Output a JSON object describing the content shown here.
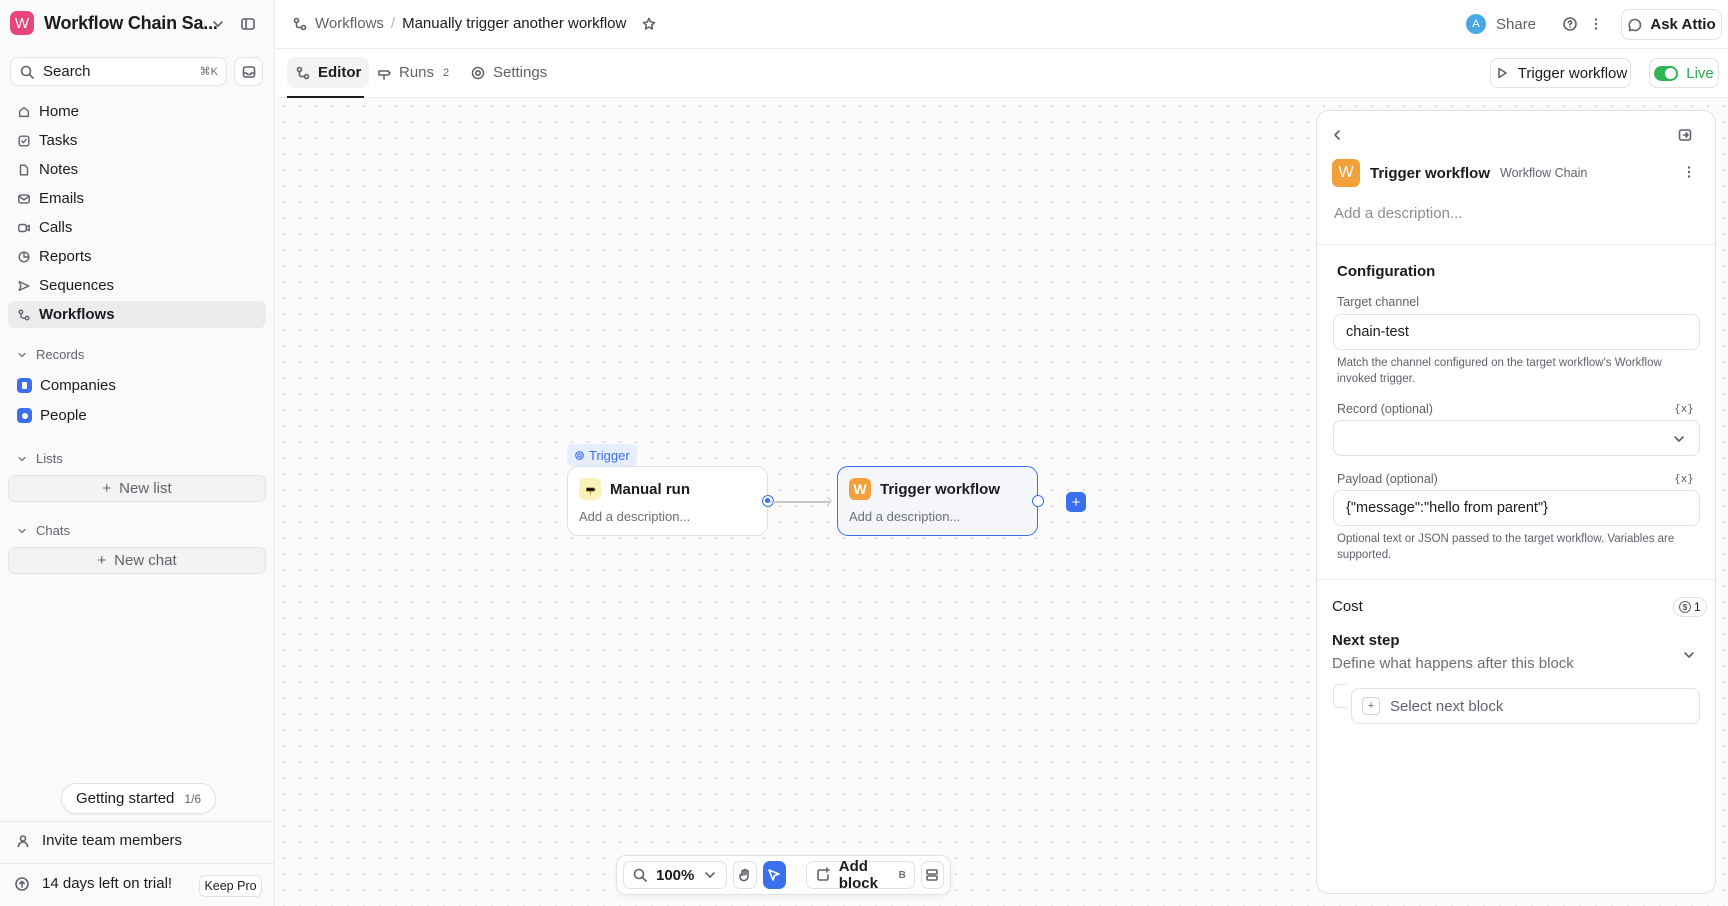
{
  "workspace": {
    "logo": "W",
    "name": "Workflow Chain Sa...",
    "logo_color": "#e8467c"
  },
  "search": {
    "label": "Search",
    "shortcut": "⌘K"
  },
  "nav": [
    {
      "label": "Home",
      "icon": "home-icon"
    },
    {
      "label": "Tasks",
      "icon": "checkbox-icon"
    },
    {
      "label": "Notes",
      "icon": "note-icon"
    },
    {
      "label": "Emails",
      "icon": "mail-icon"
    },
    {
      "label": "Calls",
      "icon": "video-icon"
    },
    {
      "label": "Reports",
      "icon": "chart-icon"
    },
    {
      "label": "Sequences",
      "icon": "send-icon"
    },
    {
      "label": "Workflows",
      "icon": "workflow-icon",
      "active": true
    }
  ],
  "records": {
    "title": "Records",
    "items": [
      {
        "label": "Companies",
        "icon": "building-icon"
      },
      {
        "label": "People",
        "icon": "person-icon"
      }
    ]
  },
  "lists": {
    "title": "Lists",
    "new_label": "New list"
  },
  "chats": {
    "title": "Chats",
    "new_label": "New chat"
  },
  "getting_started": {
    "label": "Getting started",
    "progress": "1/6"
  },
  "invite": {
    "label": "Invite team members"
  },
  "trial": {
    "label": "14 days left on trial!",
    "button": "Keep Pro"
  },
  "breadcrumb": {
    "parent": "Workflows",
    "current": "Manually trigger another workflow"
  },
  "topbar": {
    "avatar": "A",
    "share": "Share",
    "ask": "Ask Attio"
  },
  "tabs": [
    {
      "label": "Editor",
      "active": true
    },
    {
      "label": "Runs",
      "badge": "2"
    },
    {
      "label": "Settings"
    }
  ],
  "actions": {
    "trigger": "Trigger workflow",
    "live": "Live",
    "live_color": "#32b458"
  },
  "canvas": {
    "trigger_tag": "Trigger",
    "node_manual": {
      "title": "Manual run",
      "desc": "Add a description..."
    },
    "node_trigger": {
      "logo": "W",
      "title": "Trigger workflow",
      "desc": "Add a description..."
    },
    "add": "+"
  },
  "toolbar": {
    "zoom": "100%",
    "add_block": "Add block",
    "add_key": "B"
  },
  "panel": {
    "logo": "W",
    "title": "Trigger workflow",
    "subtitle": "Workflow Chain",
    "desc_placeholder": "Add a description...",
    "config_title": "Configuration",
    "target_label": "Target channel",
    "target_value": "chain-test",
    "target_hint": "Match the channel configured on the target workflow's Workflow invoked trigger.",
    "record_label": "Record (optional)",
    "record_var": "{x}",
    "payload_label": "Payload (optional)",
    "payload_var": "{x}",
    "payload_value": "{\"message\":\"hello from parent\"}",
    "payload_hint": "Optional text or JSON passed to the target workflow. Variables are supported.",
    "cost_label": "Cost",
    "cost_coin": "$",
    "cost_value": "1",
    "next_title": "Next step",
    "next_sub": "Define what happens after this block",
    "next_plus": "+",
    "next_select": "Select next block"
  },
  "colors": {
    "accent": "#3a6ff0",
    "workflow_logo": "#f2a13a"
  }
}
